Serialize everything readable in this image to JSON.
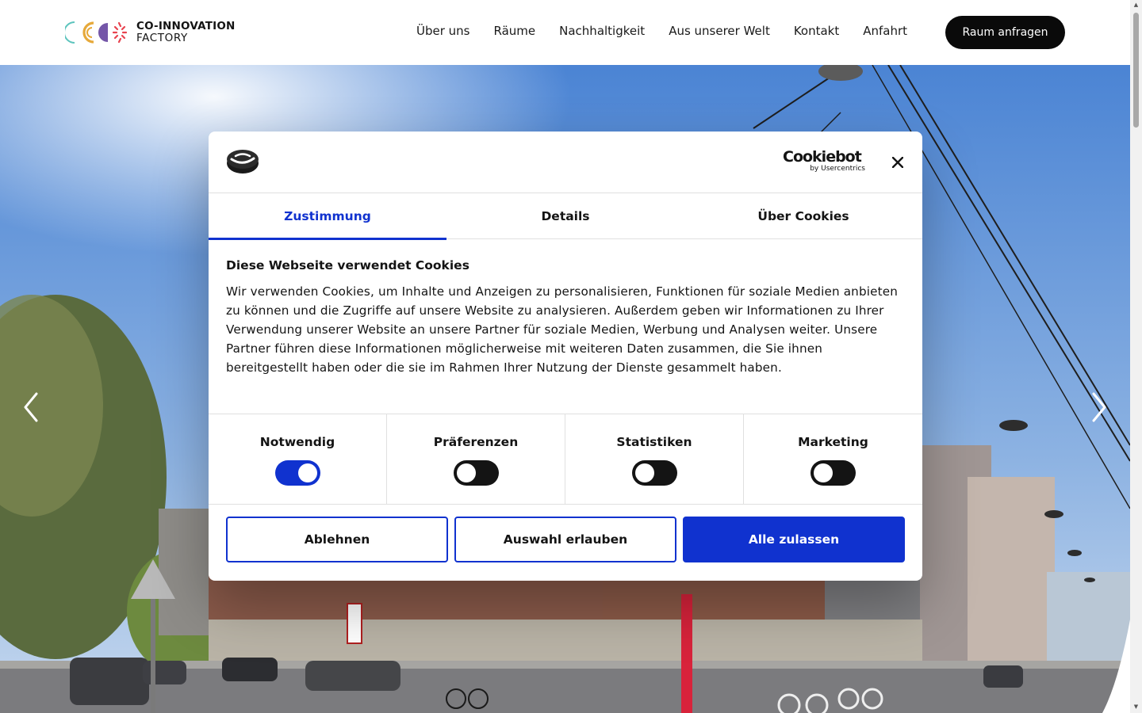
{
  "header": {
    "logo_line1": "CO-INNOVATION",
    "logo_line2": "FACTORY",
    "nav": [
      "Über uns",
      "Räume",
      "Nachhaltigkeit",
      "Aus unserer Welt",
      "Kontakt",
      "Anfahrt"
    ],
    "cta_label": "Raum anfragen"
  },
  "hero": {
    "prev_icon": "chevron-left-icon",
    "next_icon": "chevron-right-icon"
  },
  "cookie_dialog": {
    "brand": "Cookiebot",
    "brand_sub": "by Usercentrics",
    "close_icon": "close-icon",
    "tabs": [
      {
        "label": "Zustimmung",
        "active": true
      },
      {
        "label": "Details",
        "active": false
      },
      {
        "label": "Über Cookies",
        "active": false
      }
    ],
    "title": "Diese Webseite verwendet Cookies",
    "text": "Wir verwenden Cookies, um Inhalte und Anzeigen zu personalisieren, Funktionen für soziale Medien anbieten zu können und die Zugriffe auf unsere Website zu analysieren. Außerdem geben wir Informationen zu Ihrer Verwendung unserer Website an unsere Partner für soziale Medien, Werbung und Analysen weiter. Unsere Partner führen diese Informationen möglicherweise mit weiteren Daten zusammen, die Sie ihnen bereitgestellt haben oder die sie im Rahmen Ihrer Nutzung der Dienste gesammelt haben.",
    "toggles": [
      {
        "label": "Notwendig",
        "on": true
      },
      {
        "label": "Präferenzen",
        "on": false
      },
      {
        "label": "Statistiken",
        "on": false
      },
      {
        "label": "Marketing",
        "on": false
      }
    ],
    "buttons": {
      "reject": "Ablehnen",
      "allow_selection": "Auswahl erlauben",
      "allow_all": "Alle zulassen"
    }
  },
  "colors": {
    "accent": "#1032cf",
    "header_bg": "#ffffff",
    "cta_bg": "#0a0a0a"
  }
}
